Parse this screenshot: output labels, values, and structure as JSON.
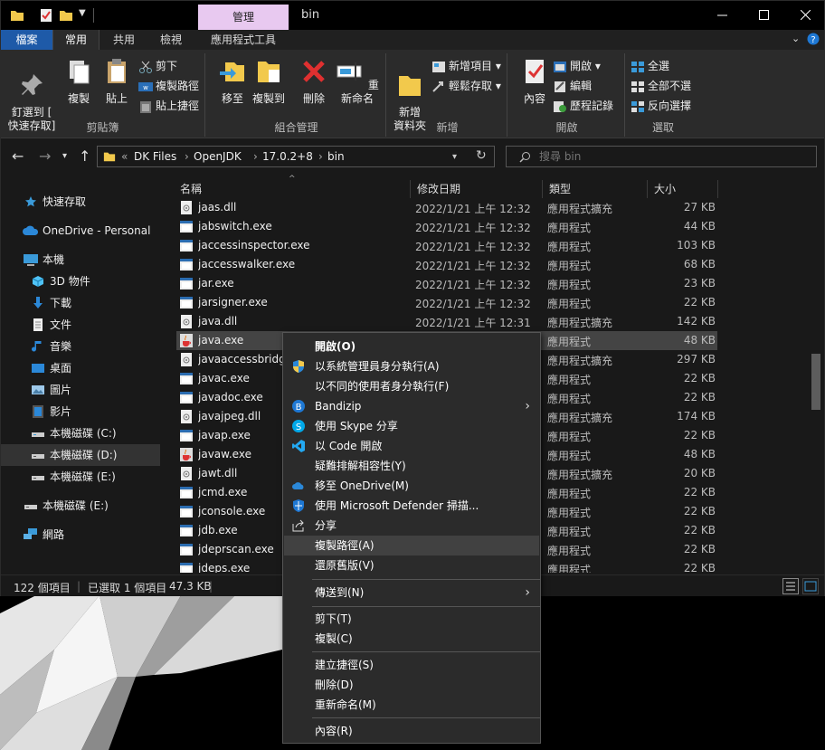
{
  "title_bar": {
    "context_tab": "管理",
    "title": "bin",
    "min_icon": "minimize-icon",
    "max_icon": "maximize-icon",
    "close_icon": "close-icon"
  },
  "ribbon_tabs": {
    "file": "檔案",
    "home": "常用",
    "share": "共用",
    "view": "檢視",
    "app_tools": "應用程式工具"
  },
  "ribbon": {
    "clipboard": {
      "label": "剪貼簿",
      "pin": "釘選到 [\n快速存取]",
      "copy": "複製",
      "paste": "貼上",
      "cut": "剪下",
      "copy_path": "複製路徑",
      "paste_shortcut": "貼上捷徑"
    },
    "organize": {
      "label": "組合管理",
      "move_to": "移至",
      "copy_to": "複製到",
      "delete": "刪除",
      "rename": "重新命名"
    },
    "new": {
      "label": "新增",
      "new_folder": "新增\n資料夾",
      "new_item": "新增項目",
      "easy_access": "輕鬆存取"
    },
    "open": {
      "label": "開啟",
      "properties": "內容",
      "open": "開啟",
      "edit": "編輯",
      "history": "歷程記錄"
    },
    "select": {
      "label": "選取",
      "select_all": "全選",
      "select_none": "全部不選",
      "invert": "反向選擇"
    }
  },
  "address": {
    "prefix": "«",
    "crumbs": [
      "DK Files",
      "OpenJDK",
      "17.0.2+8",
      "bin"
    ],
    "search_placeholder": "搜尋 bin"
  },
  "nav_pane": {
    "quick_access": "快速存取",
    "onedrive": "OneDrive - Personal",
    "this_pc": "本機",
    "objects3d": "3D 物件",
    "downloads": "下載",
    "documents": "文件",
    "music": "音樂",
    "desktop": "桌面",
    "pictures": "圖片",
    "videos": "影片",
    "disk_c": "本機磁碟 (C:)",
    "disk_d": "本機磁碟 (D:)",
    "disk_e": "本機磁碟 (E:)",
    "disk_e2": "本機磁碟 (E:)",
    "network": "網路"
  },
  "columns": {
    "name": "名稱",
    "date": "修改日期",
    "type": "類型",
    "size": "大小"
  },
  "files": [
    {
      "name": "jaas.dll",
      "date": "2022/1/21 上午 12:32",
      "type": "應用程式擴充",
      "size": "27 KB",
      "kind": "dll"
    },
    {
      "name": "jabswitch.exe",
      "date": "2022/1/21 上午 12:32",
      "type": "應用程式",
      "size": "44 KB",
      "kind": "exe"
    },
    {
      "name": "jaccessinspector.exe",
      "date": "2022/1/21 上午 12:32",
      "type": "應用程式",
      "size": "103 KB",
      "kind": "exe"
    },
    {
      "name": "jaccesswalker.exe",
      "date": "2022/1/21 上午 12:32",
      "type": "應用程式",
      "size": "68 KB",
      "kind": "exe"
    },
    {
      "name": "jar.exe",
      "date": "2022/1/21 上午 12:32",
      "type": "應用程式",
      "size": "23 KB",
      "kind": "exe"
    },
    {
      "name": "jarsigner.exe",
      "date": "2022/1/21 上午 12:32",
      "type": "應用程式",
      "size": "22 KB",
      "kind": "exe"
    },
    {
      "name": "java.dll",
      "date": "2022/1/21 上午 12:31",
      "type": "應用程式擴充",
      "size": "142 KB",
      "kind": "dll"
    },
    {
      "name": "java.exe",
      "date": "2022/1/21 上午 12:32",
      "type": "應用程式",
      "size": "48 KB",
      "kind": "java"
    },
    {
      "name": "javaaccessbridge",
      "date": "",
      "type": "應用程式擴充",
      "size": "297 KB",
      "kind": "dll"
    },
    {
      "name": "javac.exe",
      "date": "",
      "type": "應用程式",
      "size": "22 KB",
      "kind": "exe"
    },
    {
      "name": "javadoc.exe",
      "date": "",
      "type": "應用程式",
      "size": "22 KB",
      "kind": "exe"
    },
    {
      "name": "javajpeg.dll",
      "date": "",
      "type": "應用程式擴充",
      "size": "174 KB",
      "kind": "dll"
    },
    {
      "name": "javap.exe",
      "date": "",
      "type": "應用程式",
      "size": "22 KB",
      "kind": "exe"
    },
    {
      "name": "javaw.exe",
      "date": "",
      "type": "應用程式",
      "size": "48 KB",
      "kind": "java"
    },
    {
      "name": "jawt.dll",
      "date": "",
      "type": "應用程式擴充",
      "size": "20 KB",
      "kind": "dll"
    },
    {
      "name": "jcmd.exe",
      "date": "",
      "type": "應用程式",
      "size": "22 KB",
      "kind": "exe"
    },
    {
      "name": "jconsole.exe",
      "date": "",
      "type": "應用程式",
      "size": "22 KB",
      "kind": "exe"
    },
    {
      "name": "jdb.exe",
      "date": "",
      "type": "應用程式",
      "size": "22 KB",
      "kind": "exe"
    },
    {
      "name": "jdeprscan.exe",
      "date": "",
      "type": "應用程式",
      "size": "22 KB",
      "kind": "exe"
    },
    {
      "name": "jdeps.exe",
      "date": "",
      "type": "應用程式",
      "size": "22 KB",
      "kind": "exe"
    }
  ],
  "status": {
    "count": "122 個項目",
    "selected": "已選取 1 個項目",
    "size": "47.3 KB"
  },
  "context_menu": {
    "open": "開啟(O)",
    "run_admin": "以系統管理員身分執行(A)",
    "run_other": "以不同的使用者身分執行(F)",
    "bandizip": "Bandizip",
    "skype": "使用 Skype 分享",
    "vscode": "以 Code 開啟",
    "troubleshoot": "疑難排解相容性(Y)",
    "onedrive": "移至 OneDrive(M)",
    "defender": "使用 Microsoft Defender 掃描...",
    "share": "分享",
    "copy_path": "複製路徑(A)",
    "restore": "還原舊版(V)",
    "send_to": "傳送到(N)",
    "cut": "剪下(T)",
    "copy": "複製(C)",
    "shortcut": "建立捷徑(S)",
    "delete": "刪除(D)",
    "rename": "重新命名(M)",
    "properties": "內容(R)"
  },
  "colors": {
    "file_tab": "#1e5aa8",
    "context_tab": "#e8c9f0",
    "folder": "#f2c94c",
    "accent_blue": "#3a9ad9"
  }
}
